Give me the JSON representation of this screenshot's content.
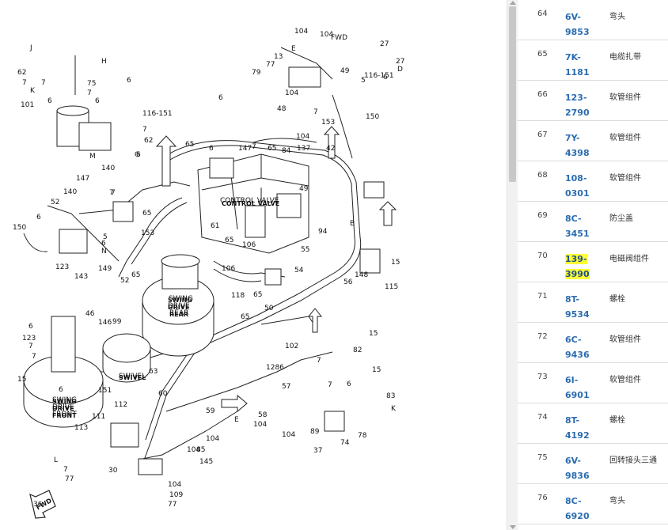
{
  "diagram": {
    "labels": [
      "J",
      "62",
      "7",
      "101",
      "K",
      "7",
      "6",
      "H",
      "75",
      "6",
      "7",
      "116-151",
      "7",
      "62",
      "6",
      "6",
      "G",
      "140",
      "M",
      "7",
      "147",
      "65",
      "65",
      "140",
      "7",
      "150",
      "52",
      "6",
      "123",
      "143",
      "149",
      "N",
      "153",
      "5",
      "6",
      "52",
      "65",
      "61",
      "CONTROL VALVE",
      "106",
      "65",
      "106",
      "118",
      "65",
      "54",
      "56",
      "94",
      "49",
      "55",
      "115",
      "148",
      "15",
      "SWING",
      "DRIVE",
      "REAR",
      "46",
      "146",
      "99",
      "6",
      "123",
      "7",
      "7",
      "15",
      "6",
      "SWIVEL",
      "SWING",
      "DRIVE",
      "FRONT",
      "151",
      "63",
      "65",
      "50",
      "111",
      "112",
      "113",
      "60",
      "59",
      "104",
      "58",
      "E",
      "104",
      "89",
      "37",
      "74",
      "78",
      "83",
      "7",
      "57",
      "6",
      "15",
      "K",
      "7",
      "15",
      "1286",
      "102",
      "82",
      "L",
      "7",
      "77",
      "30",
      "104",
      "109",
      "77",
      "145",
      "104",
      "104",
      "85",
      "36",
      "104",
      "104",
      "FWD",
      "E",
      "13",
      "77",
      "79",
      "6",
      "104",
      "48",
      "49",
      "116-151",
      "5",
      "7",
      "150",
      "153",
      "D",
      "6",
      "27",
      "27",
      "7",
      "84",
      "104",
      "B",
      "6",
      "147",
      "65",
      "137",
      "42"
    ],
    "callouts": {
      "control_valve": "CONTROL VALVE",
      "swing_rear_1": "SWING",
      "swing_rear_2": "DRIVE",
      "swing_rear_3": "REAR",
      "swing_front_1": "SWING",
      "swing_front_2": "DRIVE",
      "swing_front_3": "FRONT",
      "swivel": "SWIVEL",
      "fwd": "FWD"
    }
  },
  "parts": [
    {
      "no": "64",
      "pn": "6V-9853",
      "desc": "弯头",
      "highlight": false
    },
    {
      "no": "65",
      "pn": "7K-1181",
      "desc": "电缆扎带",
      "highlight": false
    },
    {
      "no": "66",
      "pn": "123-2790",
      "desc": "软管组件",
      "highlight": false
    },
    {
      "no": "67",
      "pn": "7Y-4398",
      "desc": "软管组件",
      "highlight": false
    },
    {
      "no": "68",
      "pn": "108-0301",
      "desc": "软管组件",
      "highlight": false
    },
    {
      "no": "69",
      "pn": "8C-3451",
      "desc": "防尘盖",
      "highlight": false
    },
    {
      "no": "70",
      "pn": "139-3990",
      "desc": "电磁阀组件",
      "highlight": true
    },
    {
      "no": "71",
      "pn": "8T-9534",
      "desc": "螺栓",
      "highlight": false
    },
    {
      "no": "72",
      "pn": "6C-9436",
      "desc": "软管组件",
      "highlight": false
    },
    {
      "no": "73",
      "pn": "6I-6901",
      "desc": "软管组件",
      "highlight": false
    },
    {
      "no": "74",
      "pn": "8T-4192",
      "desc": "螺栓",
      "highlight": false
    },
    {
      "no": "75",
      "pn": "6V-9836",
      "desc": "回转接头三通",
      "highlight": false
    },
    {
      "no": "76",
      "pn": "8C-6920",
      "desc": "弯头",
      "highlight": false
    }
  ],
  "colors": {
    "link": "#2b6cb0",
    "highlight": "#ffff33"
  }
}
